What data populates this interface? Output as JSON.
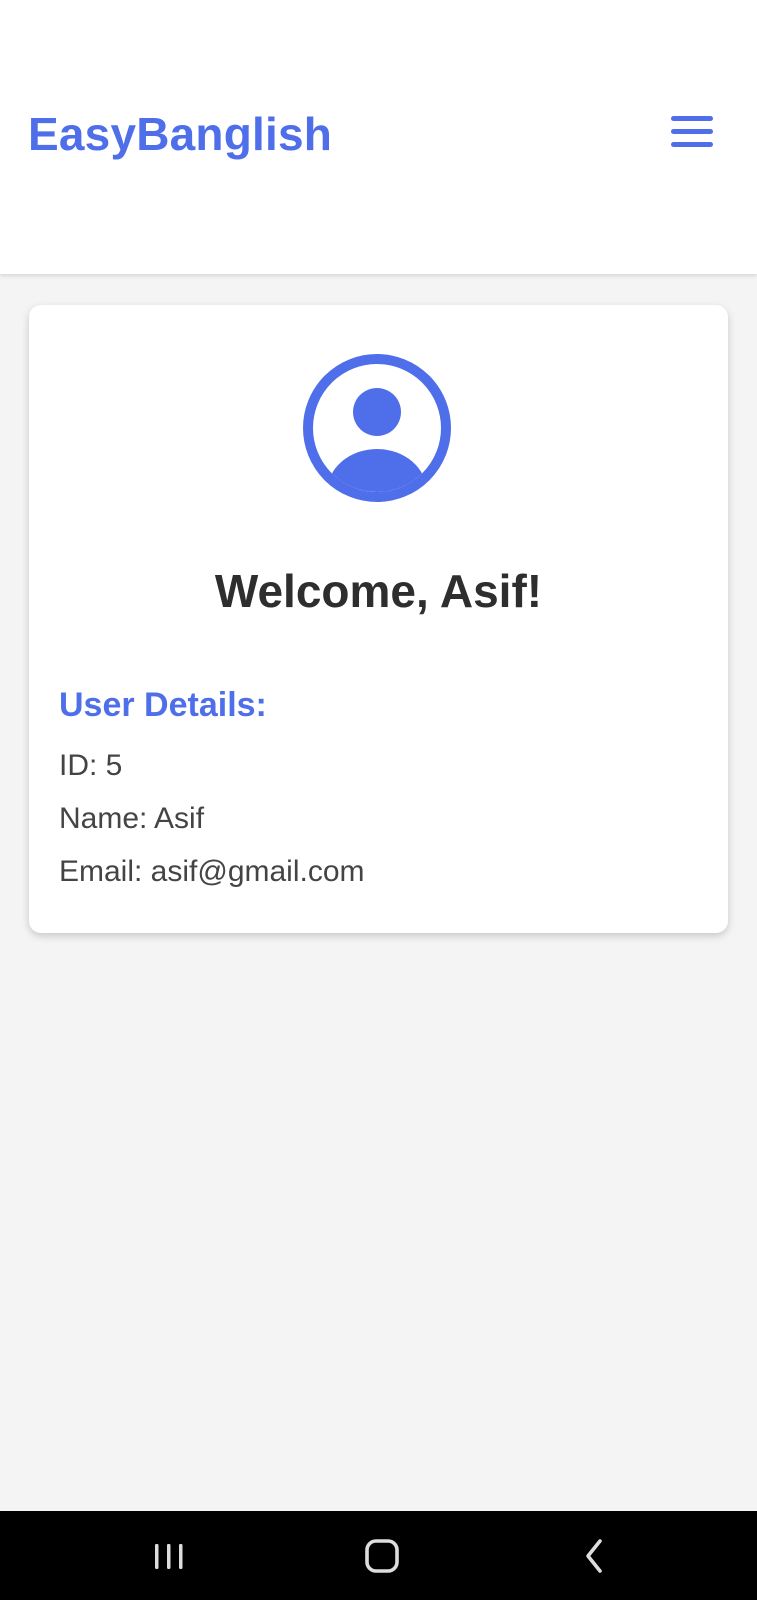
{
  "app": {
    "title": "EasyBanglish",
    "menu_icon": "hamburger-menu-icon"
  },
  "colors": {
    "brand": "#4F6FEA",
    "text_dark": "#2E2E2E",
    "text_body": "#444444",
    "background": "#F4F4F4",
    "nav_bar": "#000000",
    "nav_icon": "#DDDDDD"
  },
  "profile": {
    "avatar_icon": "user-circle-icon",
    "welcome": "Welcome, Asif!",
    "details_heading": "User Details:",
    "id_line": "ID: 5",
    "name_line": "Name: Asif",
    "email_line": "Email: asif@gmail.com"
  },
  "system_nav": {
    "recent_icon": "recent-apps-icon",
    "home_icon": "home-icon",
    "back_icon": "back-icon"
  }
}
